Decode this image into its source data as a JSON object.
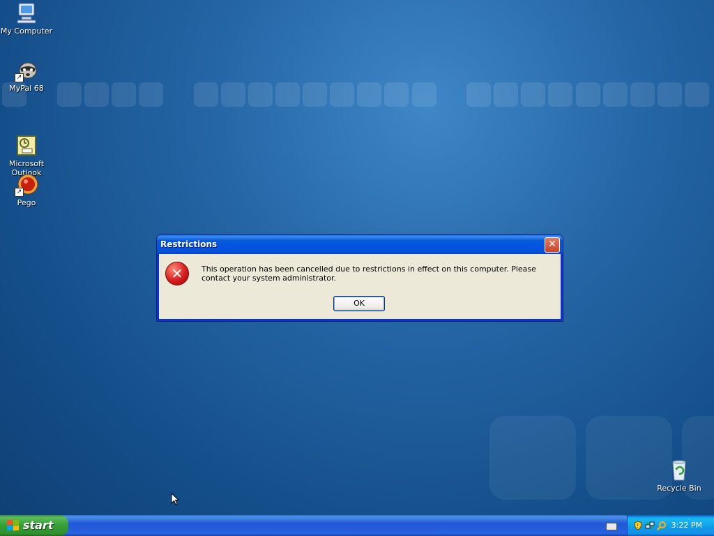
{
  "desktop": {
    "icons": [
      {
        "label": "My Computer",
        "icon": "computer-icon"
      },
      {
        "label": "MyPal 68",
        "icon": "mypal-icon"
      },
      {
        "label": "Microsoft\nOutlook",
        "icon": "outlook-icon"
      },
      {
        "label": "Pego",
        "icon": "pego-icon"
      },
      {
        "label": "Recycle Bin",
        "icon": "recycle-bin-icon"
      }
    ]
  },
  "dialog": {
    "title": "Restrictions",
    "close_glyph": "✕",
    "error_glyph": "✕",
    "message": "This operation has been cancelled due to restrictions in effect on this computer. Please contact your system administrator.",
    "ok_label": "OK"
  },
  "taskbar": {
    "start_label": "start",
    "clock": "3:22 PM",
    "tray_icons": [
      "keyboard-icon",
      "security-shield-icon",
      "network-icon",
      "search-icon"
    ]
  },
  "colors": {
    "desktop_bg": "#2566a6",
    "titlebar": "#0254e4",
    "dialog_bg": "#ece9d8",
    "start_green": "#37a137",
    "error_red": "#d61c1c"
  }
}
